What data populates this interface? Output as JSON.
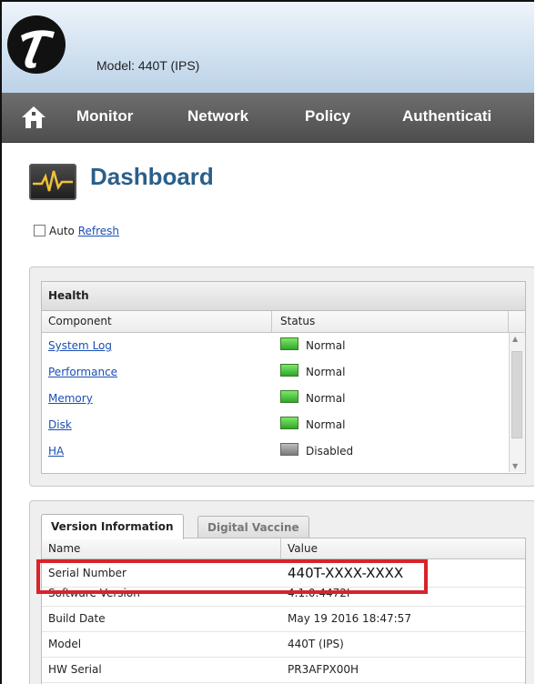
{
  "header": {
    "model_label": "Model: 440T (IPS)"
  },
  "nav": {
    "items": [
      "Monitor",
      "Network",
      "Policy",
      "Authenticati"
    ]
  },
  "page": {
    "title": "Dashboard",
    "auto_label": "Auto",
    "refresh_link": "Refresh"
  },
  "health": {
    "title": "Health",
    "columns": [
      "Component",
      "Status"
    ],
    "rows": [
      {
        "component": "System Log",
        "status": "Normal",
        "state": "ok"
      },
      {
        "component": "Performance",
        "status": "Normal",
        "state": "ok"
      },
      {
        "component": "Memory",
        "status": "Normal",
        "state": "ok"
      },
      {
        "component": "Disk",
        "status": "Normal",
        "state": "ok"
      },
      {
        "component": "HA",
        "status": "Disabled",
        "state": "disabled"
      }
    ]
  },
  "version": {
    "tabs": [
      "Version Information",
      "Digital Vaccine"
    ],
    "columns": [
      "Name",
      "Value"
    ],
    "rows": [
      {
        "name": "Serial Number",
        "value": "440T-XXXX-XXXX"
      },
      {
        "name": "Software Version",
        "value": "4.1.0.4472I"
      },
      {
        "name": "Build Date",
        "value": "May 19 2016 18:47:57"
      },
      {
        "name": "Model",
        "value": "440T (IPS)"
      },
      {
        "name": "HW Serial",
        "value": "PR3AFPX00H"
      }
    ]
  },
  "colors": {
    "highlight": "#d8232a",
    "title": "#2a5f8a",
    "link": "#1a4fb5",
    "status_ok": "#2fa82a",
    "status_disabled": "#7b7b7b"
  }
}
